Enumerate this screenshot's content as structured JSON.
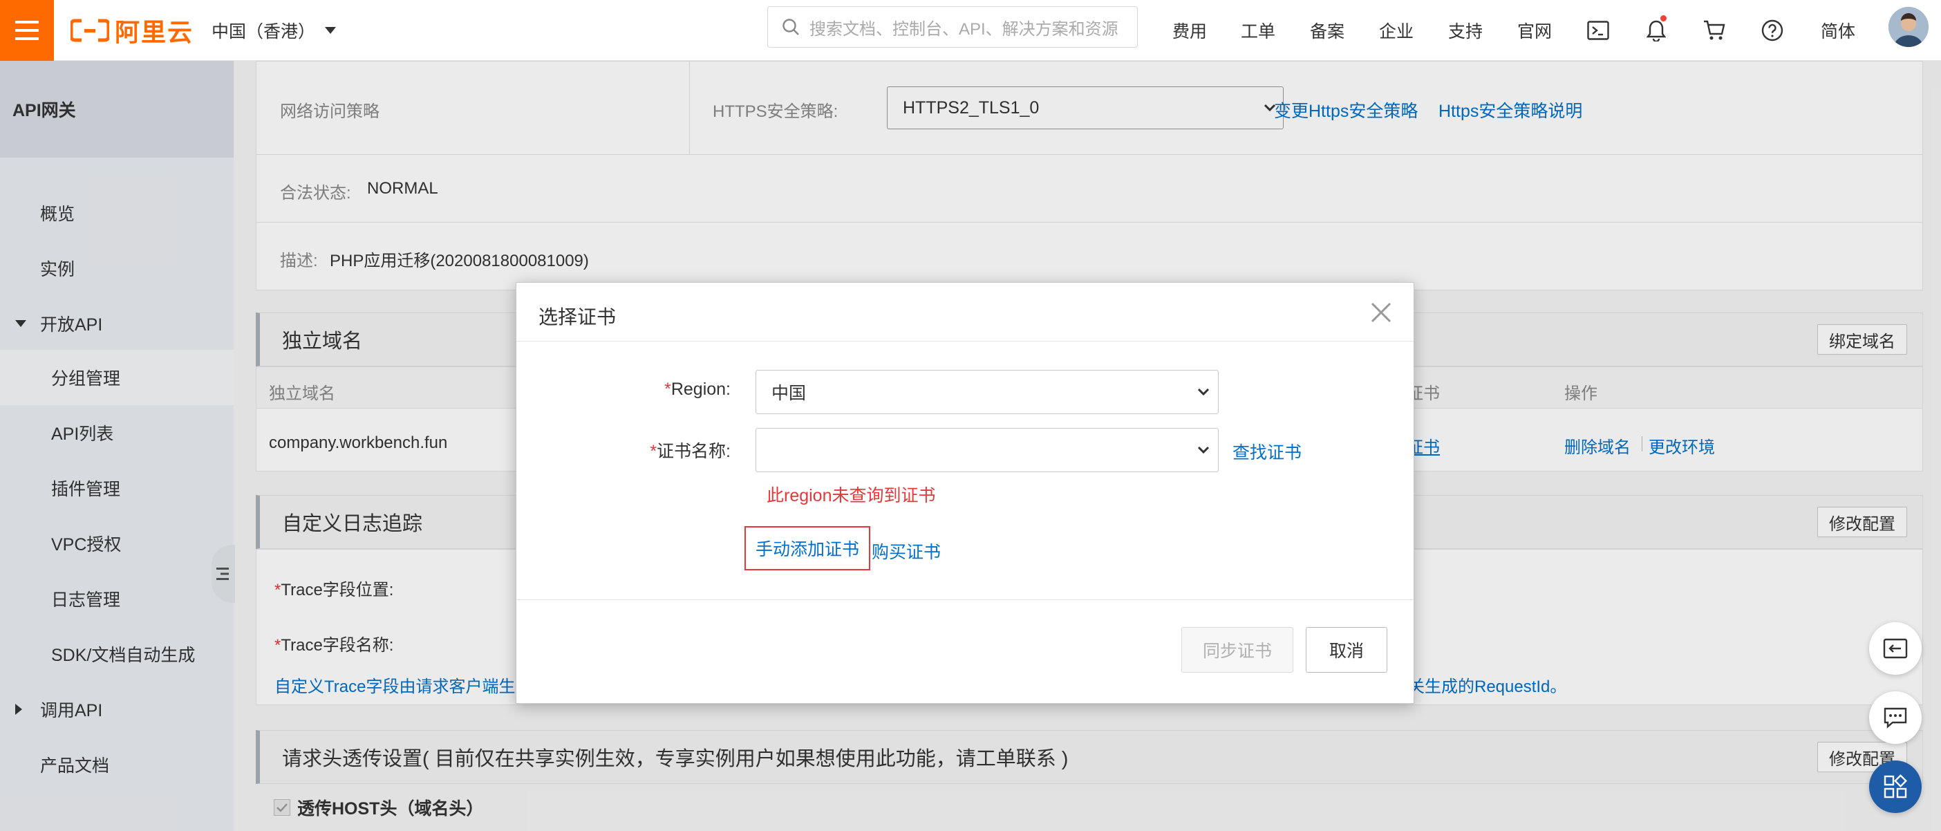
{
  "topbar": {
    "logo_text": "阿里云",
    "region": "中国（香港）",
    "search_placeholder": "搜索文档、控制台、API、解决方案和资源",
    "nav": [
      "费用",
      "工单",
      "备案",
      "企业",
      "支持",
      "官网"
    ],
    "lang": "简体",
    "brand_color": "#ff6a00"
  },
  "sidebar": {
    "title": "API网关",
    "items": [
      {
        "label": "概览"
      },
      {
        "label": "实例"
      },
      {
        "label": "开放API"
      },
      {
        "label": "分组管理"
      },
      {
        "label": "API列表"
      },
      {
        "label": "插件管理"
      },
      {
        "label": "VPC授权"
      },
      {
        "label": "日志管理"
      },
      {
        "label": "SDK/文档自动生成"
      },
      {
        "label": "调用API"
      },
      {
        "label": "产品文档"
      }
    ]
  },
  "main": {
    "network_policy_label": "网络访问策略",
    "https_policy_label": "HTTPS安全策略:",
    "https_policy_value": "HTTPS2_TLS1_0",
    "change_https_link": "变更Https安全策略",
    "https_doc_link": "Https安全策略说明",
    "legal_label": "合法状态:",
    "legal_value": "NORMAL",
    "desc_label": "描述:",
    "desc_value": "PHP应用迁移(2020081800081009)",
    "domain_section": {
      "title": "独立域名",
      "button": "绑定域名",
      "col_domain": "独立域名",
      "col_cert": "证书",
      "col_ops": "操作",
      "row_domain": "company.workbench.fun",
      "row_cert_link": "证书",
      "row_delete": "删除域名",
      "row_change_env": "更改环境"
    },
    "trace_section": {
      "title": "自定义日志追踪",
      "button": "修改配置",
      "position_label": "Trace字段位置:",
      "name_label": "Trace字段名称:",
      "note_left": "自定义Trace字段由请求客户端生",
      "note_right": "关生成的RequestId。"
    },
    "header_section": {
      "title": "请求头透传设置( 目前仅在共享实例生效，专享实例用户如果想使用此功能，请工单联系 )",
      "button": "修改配置",
      "host_label": "透传HOST头（域名头）"
    }
  },
  "dialog": {
    "title": "选择证书",
    "region_label": "Region:",
    "region_value": "中国",
    "cert_label": "证书名称:",
    "cert_value": "",
    "find_cert": "查找证书",
    "error": "此region未查询到证书",
    "manual_add": "手动添加证书",
    "buy_cert": "购买证书",
    "sync_button": "同步证书",
    "cancel_button": "取消"
  }
}
